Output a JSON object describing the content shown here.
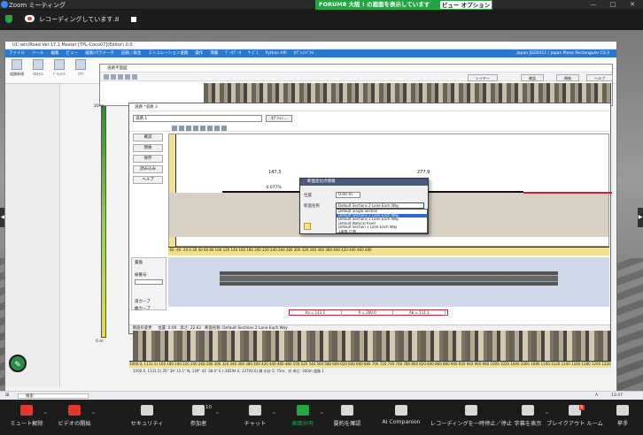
{
  "zoom": {
    "window_title": "Zoom ミーティング",
    "share_banner": "FORUM8 大阪 ! の画面を表示しています",
    "view_options": "ビュー オプション",
    "recording_text": "レコーディングしています...",
    "pause_symbol": "II",
    "toolbar": [
      {
        "label": "ミュート解除",
        "icon": "mic-off-icon"
      },
      {
        "label": "ビデオの開始",
        "icon": "video-off-icon"
      },
      {
        "label": "セキュリティ",
        "icon": "shield-icon"
      },
      {
        "label": "参加者",
        "icon": "participants-icon",
        "badge": "10"
      },
      {
        "label": "チャット",
        "icon": "chat-icon"
      },
      {
        "label": "画面共有",
        "icon": "share-screen-icon"
      },
      {
        "label": "要約を確認",
        "icon": "summary-icon"
      },
      {
        "label": "AI Companion",
        "icon": "ai-companion-icon"
      },
      {
        "label": "レコーディングを一時停止／停止",
        "icon": "pause-stop-icon"
      },
      {
        "label": "字幕を表示",
        "icon": "cc-icon"
      },
      {
        "label": "ブレイクアウト ルーム",
        "icon": "breakout-icon",
        "badge": "5"
      },
      {
        "label": "挙手",
        "icon": "raise-hand-icon"
      }
    ],
    "colors": {
      "share_green": "#23a543",
      "mic_red": "#e0382e",
      "toolbar_bg": "#1c1c1c"
    }
  },
  "app": {
    "window_title": "UC-win/Road Ver.17.1 Master [TPL-Coco07](Editor) 0.0",
    "menu": [
      "ファイル",
      "ツール",
      "編集",
      "ビュー",
      "道路/パラメータ",
      "記録／再生",
      "ミシュレーション道路",
      "操作",
      "沸腸",
      "ﾃﾞｰﾀﾃﾞｰﾀ",
      "ｻｰﾋﾞｽ",
      "Python API",
      "ｵﾌﾟｼｮﾝﾊﾟﾈﾙ"
    ],
    "menu_right": "Japan  JGD2011 / Japan Plane Rectangular CS II",
    "ribbon": [
      "道路新規",
      "ｸﾛｽﾗｲﾝ",
      "ﾄﾞｷｭﾒﾝﾄ",
      "ｱﾅﾘ"
    ],
    "top_buttons": [
      "レイヤー",
      "確認",
      "閉後",
      "ヘルプ"
    ],
    "status_left": "396/4,0 Hz, 8M (0.0 Hz (0.0Hz/0/))",
    "status_middle": "(1383.0, 884.0) HEIGHT: 86.5m (alt=1.0m)",
    "status_coord": "35° 39' 43.4\" N, 139° 41' 46.2\" E",
    "status_right": "(-38740.4, 12270.4)",
    "taskbar_search": "検索",
    "taskbar_time": "13:47",
    "taskbar_ime": "A"
  },
  "plane_window": {
    "title": "道路平面図"
  },
  "profile_window": {
    "title": "道路 *道路 2",
    "route_name": "道路 1",
    "options_button": "ｵﾌﾟｼｮﾝ...",
    "side_buttons": [
      "確認",
      "閉後",
      "保存",
      "読み込み",
      "ヘルプ"
    ],
    "values": {
      "left": "147.3",
      "right": "277.9",
      "grade": "-0.077%"
    },
    "ruler_top": "-60 -40 -20 0 20 40 60 80 100 120 140 160 180 200 220 240 260 280 300 320 340 360 380 400 420 440 460 480",
    "lower_panel": {
      "title": "置換",
      "label": "被番号",
      "row1": "道カーブ",
      "row2": "曲カーブ"
    },
    "table": [
      "Aa = 111.1",
      "R = 200.0",
      "Ab = 111.1"
    ],
    "status": [
      "断面の変更",
      "位置: 0.00",
      "高さ: 22.62",
      "断面名称: Default Sections 2 Lane Each Way"
    ]
  },
  "dialog": {
    "title": "断面変化点情報",
    "pos_label": "位置",
    "pos_value": "0.00  m",
    "section_label": "断面名称",
    "selected": "Default Sections 2 Lane Each Way",
    "options": [
      "Default Single Section",
      "Default Sections 2 Lane Each Way",
      "Default Sections 1 Lane Each Way",
      "Default Natural River",
      "Default Section 1 Lane Each Way",
      "1車線 片側",
      "2車線 片側",
      "(無題)(歩道 道路専用)"
    ],
    "selected_index": 1
  },
  "bottom_map": {
    "ruler": "1000.0, 1131.5)  160 180 200 220 240 260 280 300 320 340 360 380 400 420 440 460 480 500 520 540 560 580 600 620 640 660 680 700 720 740 760 780 800 820 840 860 880 900 920 940 960 980 1000 1020 1040 1060 1080 1100 1120 1140 1160 1180 1200 1220 1240 1260 1280",
    "status": "1000.0, 1131.5)     35° 39' 15.1\" N, 139° 41' 38.0\" E   (-38294.0, 13700.6)     触 水卦-5: 75m、対 卓辻: 300m     道路 1"
  },
  "left_scale": {
    "top": "20 m",
    "bottom": "0 m"
  }
}
